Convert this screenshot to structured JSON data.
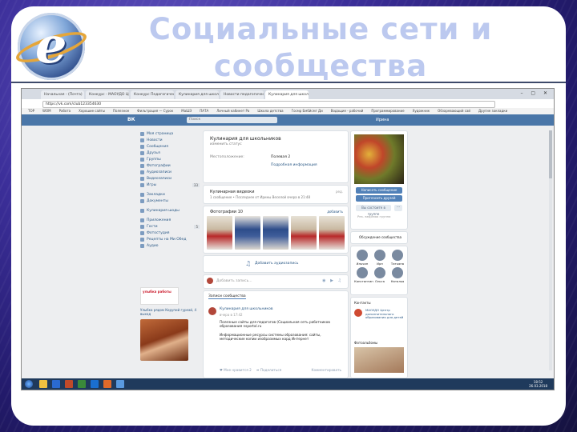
{
  "slide": {
    "title_line1": "Социальные сети и",
    "title_line2": "сообщества"
  },
  "browser": {
    "tabs": [
      "Начальная - (Почта)",
      "Конкурс - МАОУДО ЦЦ",
      "Конкурс Педагогический",
      "Кулинария для школ",
      "Новости педагогического",
      "Кулинария для школ"
    ],
    "url": "https://vk.com/club123354630",
    "bookmarks": [
      "ТОР",
      "WOM",
      "Работа",
      "Хорошие сайты",
      "Полезное",
      "Фильтрация — Сурок",
      "МаШЭ",
      "ПАТА",
      "Личный кабинет Ра",
      "Школа детства",
      "Госмр Бмбйсмг Ди",
      "Водащие - рабочий",
      "Программирование",
      "Художник",
      "Обзаревающий сай",
      "Другие закладки"
    ]
  },
  "vk": {
    "logo": "ВК",
    "search_placeholder": "Поиск",
    "user": "Ирина",
    "sidebar": [
      {
        "label": "Моя страница"
      },
      {
        "label": "Новости"
      },
      {
        "label": "Сообщения"
      },
      {
        "label": "Друзья"
      },
      {
        "label": "Группы"
      },
      {
        "label": "Фотографии"
      },
      {
        "label": "Аудиозаписи"
      },
      {
        "label": "Видеозаписи"
      },
      {
        "label": "Игры",
        "count": "33"
      },
      {
        "label": "Закладки"
      },
      {
        "label": "Документы"
      },
      {
        "label": "Кулинария шоды"
      },
      {
        "label": "Приложения"
      },
      {
        "label": "Гости",
        "count": "5"
      },
      {
        "label": "Фотостудия"
      },
      {
        "label": "Рецепты на Ми Обед"
      },
      {
        "label": "Аудио"
      }
    ],
    "ad": {
      "banner": "улыбка работы",
      "text": "Улыбка рядом Корупий гуреай, 4 выход"
    },
    "group": {
      "name": "Кулинария для школьников",
      "status": "изменить статус",
      "loc_label": "Местоположение:",
      "loc_value": "Полевая 2",
      "more": "Подробная информация"
    },
    "discussion": {
      "title": "Кулинарная видеоки",
      "sub": "1 сообщение • Последнее от Ирины Веселой вчера в 21:48",
      "action": "ред."
    },
    "photos": {
      "title": "Фотографии 10",
      "all": "добавить"
    },
    "audio": {
      "label": "Добавить аудиозапись"
    },
    "new_post": {
      "placeholder": "Добавить запись..."
    },
    "wall": {
      "tab": "Записи сообщества",
      "author": "Кулинария для школьников",
      "date": "вчера в 17:42",
      "text1": "Полезные сайты для педагогов (Социальная сеть работников образования nsportal.ru",
      "text2": "Информационные ресурсы системы образования: сайты, методические копии изобразимых кард Интернет",
      "like": "Мне нравится 2",
      "share": "Поделиться",
      "comment": "Комментировать"
    },
    "side": {
      "btn_message": "Написать сообщение",
      "btn_invite": "Пригласить друзей",
      "btn_member": "Вы состоите в группе",
      "dots": "···",
      "small": "Рек. ведомая группа",
      "members": "Обсуждение сообщества",
      "friends": [
        {
          "name": "Ильчин"
        },
        {
          "name": "Ирн"
        },
        {
          "name": "Татьяна"
        },
        {
          "name": "Константин"
        },
        {
          "name": "Ольга"
        },
        {
          "name": "Наталья"
        }
      ],
      "contacts_title": "Контакты",
      "contact": "МАОУДО Центр дополнительного образования для детей",
      "photo_albums": "Фотоальбомы"
    },
    "clock": {
      "time": "18:52",
      "date": "26.03.2018"
    }
  }
}
